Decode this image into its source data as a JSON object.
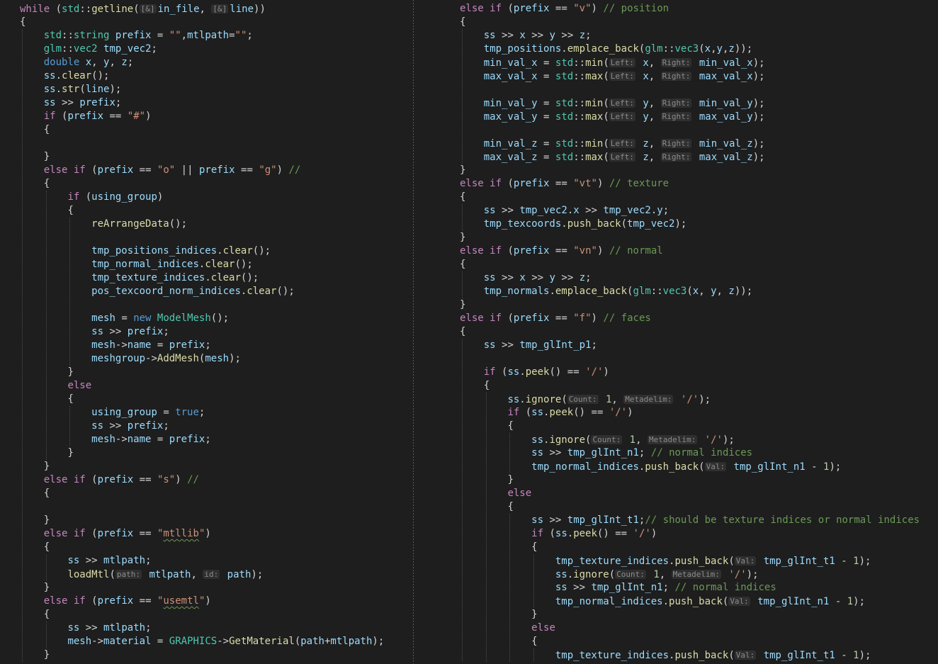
{
  "editor": {
    "colors": {
      "background": "#1e1e1e",
      "keyword": "#569cd6",
      "control": "#c586c0",
      "function": "#dcdcaa",
      "type": "#4ec9b0",
      "variable": "#9cdcfe",
      "string": "#ce9178",
      "number": "#b5cea8",
      "comment": "#6a9955"
    },
    "left_lines": [
      "while (std::getline([&]in_file, [&]line))",
      "{",
      "    std::string prefix = \"\",mtlpath=\"\";",
      "    glm::vec2 tmp_vec2;",
      "    double x, y, z;",
      "    ss.clear();",
      "    ss.str(line);",
      "    ss >> prefix;",
      "    if (prefix == \"#\")",
      "    {",
      "",
      "    }",
      "    else if (prefix == \"o\" || prefix == \"g\") //",
      "    {",
      "        if (using_group)",
      "        {",
      "            reArrangeData();",
      "",
      "            tmp_positions_indices.clear();",
      "            tmp_normal_indices.clear();",
      "            tmp_texture_indices.clear();",
      "            pos_texcoord_norm_indices.clear();",
      "",
      "            mesh = new ModelMesh();",
      "            ss >> prefix;",
      "            mesh->name = prefix;",
      "            meshgroup->AddMesh(mesh);",
      "        }",
      "        else",
      "        {",
      "            using_group = true;",
      "            ss >> prefix;",
      "            mesh->name = prefix;",
      "        }",
      "    }",
      "    else if (prefix == \"s\") //",
      "    {",
      "",
      "    }",
      "    else if (prefix == \"mtllib\")",
      "    {",
      "        ss >> mtlpath;",
      "        loadMtl(path: mtlpath, id: path);",
      "    }",
      "    else if (prefix == \"usemtl\")",
      "    {",
      "        ss >> mtlpath;",
      "        mesh->material = GRAPHICS->GetMaterial(path+mtlpath);",
      "    }"
    ],
    "right_lines": [
      "else if (prefix == \"v\") // position",
      "{",
      "    ss >> x >> y >> z;",
      "    tmp_positions.emplace_back(glm::vec3(x,y,z));",
      "    min_val_x = std::min(Left: x, Right: min_val_x);",
      "    max_val_x = std::max(Left: x, Right: max_val_x);",
      "",
      "    min_val_y = std::min(Left: y, Right: min_val_y);",
      "    max_val_y = std::max(Left: y, Right: max_val_y);",
      "",
      "    min_val_z = std::min(Left: z, Right: min_val_z);",
      "    max_val_z = std::max(Left: z, Right: max_val_z);",
      "}",
      "else if (prefix == \"vt\") // texture",
      "{",
      "    ss >> tmp_vec2.x >> tmp_vec2.y;",
      "    tmp_texcoords.push_back(tmp_vec2);",
      "}",
      "else if (prefix == \"vn\") // normal",
      "{",
      "    ss >> x >> y >> z;",
      "    tmp_normals.emplace_back(glm::vec3(x, y, z));",
      "}",
      "else if (prefix == \"f\") // faces",
      "{",
      "    ss >> tmp_glInt_p1;",
      "",
      "    if (ss.peek() == '/')",
      "    {",
      "        ss.ignore(Count: 1, Metadelim: '/');",
      "        if (ss.peek() == '/')",
      "        {",
      "            ss.ignore(Count: 1, Metadelim: '/');",
      "            ss >> tmp_glInt_n1; // normal indices",
      "            tmp_normal_indices.push_back(Val: tmp_glInt_n1 - 1);",
      "        }",
      "        else",
      "        {",
      "            ss >> tmp_glInt_t1;// should be texture indices or normal indices",
      "            if (ss.peek() == '/')",
      "            {",
      "                tmp_texture_indices.push_back(Val: tmp_glInt_t1 - 1);",
      "                ss.ignore(Count: 1, Metadelim: '/');",
      "                ss >> tmp_glInt_n1; // normal indices",
      "                tmp_normal_indices.push_back(Val: tmp_glInt_n1 - 1);",
      "            }",
      "            else",
      "            {",
      "                tmp_texture_indices.push_back(Val: tmp_glInt_t1 - 1);"
    ]
  }
}
